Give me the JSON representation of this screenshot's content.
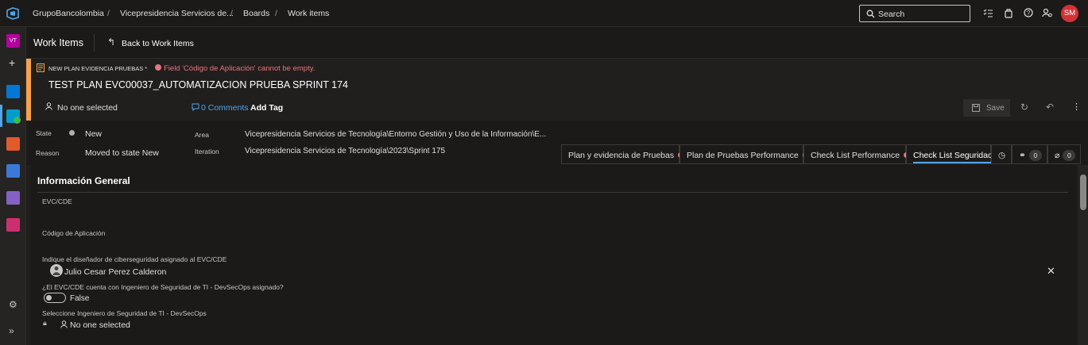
{
  "breadcrumb": {
    "org": "GrupoBancolombia",
    "project": "Vicepresidencia Servicios de...",
    "section": "Boards",
    "page": "Work items"
  },
  "top_icons": {
    "logo": "azure-devops-logo-icon",
    "search_icon": "search-icon",
    "search_label": "Search",
    "icons": [
      "task-list-icon",
      "marketplace-bag-icon",
      "help-icon",
      "user-settings-icon"
    ],
    "avatar_initials": "SM"
  },
  "left_nav": {
    "project_tile": "VT",
    "add_icon": "plus-icon",
    "items": [
      "overview-icon",
      "boards-icon",
      "repos-icon",
      "pipelines-icon",
      "test-plans-icon",
      "artifacts-icon"
    ],
    "settings_icon": "gear-icon",
    "expand_icon": "double-chevron-icon"
  },
  "header": {
    "title": "Work Items",
    "back_label": "Back to Work Items"
  },
  "work_item": {
    "type_label": "NEW PLAN EVIDENCIA PRUEBAS *",
    "error_text": "Field 'Código de Aplicación' cannot be empty.",
    "title": "TEST PLAN EVC00037_AUTOMATIZACION PRUEBA SPRINT 174",
    "assigned": "No one selected",
    "comments": "0 Comments",
    "add_tag": "Add Tag",
    "save_label": "Save"
  },
  "fields": {
    "state_label": "State",
    "state_value": "New",
    "reason_label": "Reason",
    "reason_value": "Moved to state New",
    "area_label": "Area",
    "area_value": "Vicepresidencia Servicios de Tecnología\\Entorno Gestión y Uso de la Información\\E...",
    "iteration_label": "Iteration",
    "iteration_value": "Vicepresidencia Servicios de Tecnología\\2023\\Sprint 175"
  },
  "tabs": [
    {
      "label": "Plan y evidencia de Pruebas",
      "error": true
    },
    {
      "label": "Plan de Pruebas Performance",
      "error": true
    },
    {
      "label": "Check List Performance",
      "error": true
    },
    {
      "label": "Check List Seguridad",
      "error": false,
      "active": true
    }
  ],
  "tab_counts": {
    "links": "0",
    "attachments": "0"
  },
  "section": {
    "title": "Información General",
    "evc_label": "EVC/CDE",
    "codigo_label": "Código de Aplicación",
    "disenador_label": "Indique el diseñador de ciberseguridad asignado al EVC/CDE",
    "disenador_value": "Julio Cesar Perez Calderon",
    "ingeniero_q_label": "¿El EVC/CDE cuenta con Ingeniero de Seguridad de TI - DevSecOps asignado?",
    "toggle_value": "False",
    "seleccione_label": "Seleccione Ingeniero de Seguridad de TI - DevSecOps",
    "seleccione_value": "No one selected"
  },
  "colors": {
    "accent": "#f7a24b",
    "error": "#e8737f",
    "link": "#4fa6e8",
    "avatar": "#d13438"
  }
}
